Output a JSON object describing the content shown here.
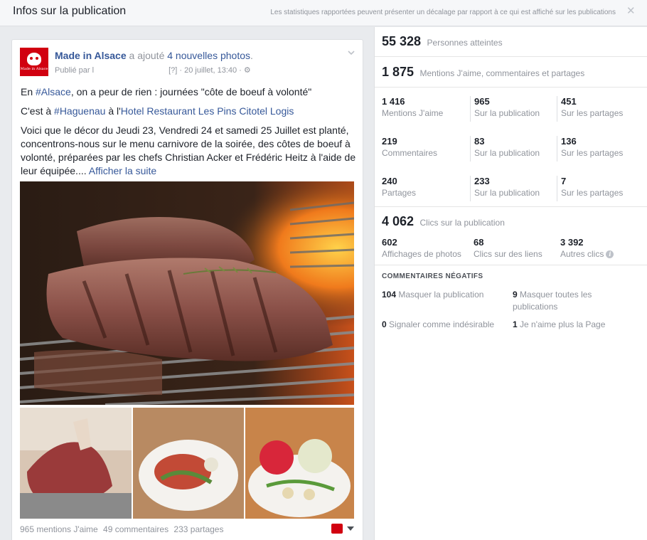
{
  "header": {
    "title": "Infos sur la publication",
    "note": "Les statistiques rapportées peuvent présenter un décalage par rapport à ce qui est affiché sur les publications",
    "close_glyph": "✕"
  },
  "post": {
    "author": "Made in Alsace",
    "action": "a ajouté",
    "photos_link": "4 nouvelles photos",
    "published_by": "Publié par l",
    "help": "[?]",
    "date": "· 20 juillet, 13:40 ·",
    "settings_glyph": "⚙",
    "avatar_text": "Made in Alsace",
    "line1_pre": "En ",
    "line1_tag": "#Alsace",
    "line1_post": ", on a peur de rien : journées \"côte de boeuf à volonté\"",
    "line2_pre": "C'est à ",
    "line2_tag": "#Haguenau",
    "line2_mid": " à l'",
    "line2_link": "Hotel Restaurant Les Pins Citotel Logis",
    "line3": "Voici que le décor du Jeudi 23, Vendredi 24 et samedi 25 Juillet est planté, concentrons-nous sur le menu carnivore de la soirée, des côtes de boeuf à volonté, préparées par les chefs Christian Acker et Frédéric Heitz à l'aide de leur équipée....",
    "see_more": "Afficher la suite",
    "footer": {
      "likes": "965 mentions J'aime",
      "comments": "49 commentaires",
      "shares": "233 partages"
    }
  },
  "stats": {
    "reach": {
      "value": "55 328",
      "label": "Personnes atteintes"
    },
    "engagement": {
      "value": "1 875",
      "label": "Mentions J'aime, commentaires et partages"
    },
    "rows": [
      [
        {
          "value": "1 416",
          "label": "Mentions J'aime"
        },
        {
          "value": "965",
          "label": "Sur la publication"
        },
        {
          "value": "451",
          "label": "Sur les partages"
        }
      ],
      [
        {
          "value": "219",
          "label": "Commentaires"
        },
        {
          "value": "83",
          "label": "Sur la publication"
        },
        {
          "value": "136",
          "label": "Sur les partages"
        }
      ],
      [
        {
          "value": "240",
          "label": "Partages"
        },
        {
          "value": "233",
          "label": "Sur la publication"
        },
        {
          "value": "7",
          "label": "Sur les partages"
        }
      ]
    ],
    "clicks": {
      "value": "4 062",
      "label": "Clics sur la publication"
    },
    "click_row": [
      {
        "value": "602",
        "label": "Affichages de photos"
      },
      {
        "value": "68",
        "label": "Clics sur des liens"
      },
      {
        "value": "3 392",
        "label": "Autres clics"
      }
    ],
    "info_glyph": "i"
  },
  "negative": {
    "title": "COMMENTAIRES NÉGATIFS",
    "items": [
      {
        "value": "104",
        "label": "Masquer la publication"
      },
      {
        "value": "9",
        "label": "Masquer toutes les publications"
      },
      {
        "value": "0",
        "label": "Signaler comme indésirable"
      },
      {
        "value": "1",
        "label": "Je n'aime plus la Page"
      }
    ]
  }
}
